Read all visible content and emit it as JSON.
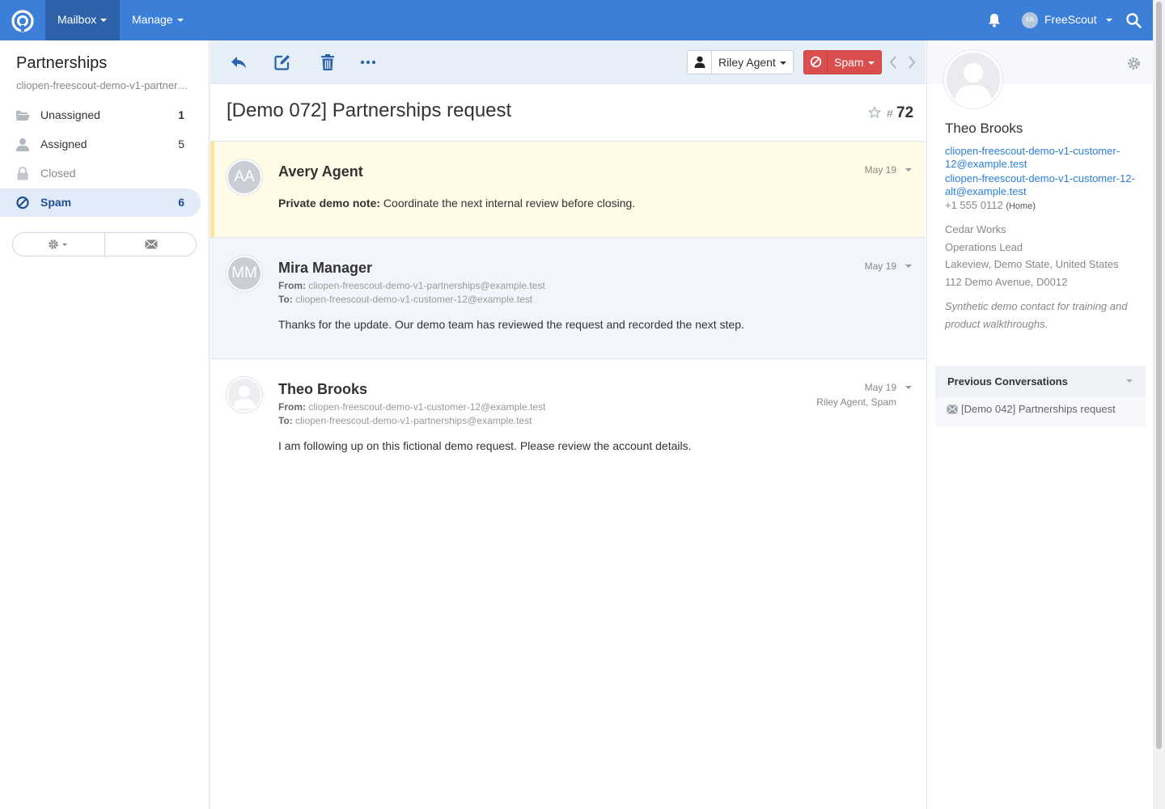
{
  "topnav": {
    "mailbox_label": "Mailbox",
    "manage_label": "Manage",
    "user_initials": "FA",
    "user_name": "FreeScout",
    "accent": "#3c7fd8"
  },
  "sidebar": {
    "mailbox_name": "Partnerships",
    "mailbox_email": "cliopen-freescout-demo-v1-partnerships@example.test",
    "folders": [
      {
        "label": "Unassigned",
        "count": "1"
      },
      {
        "label": "Assigned",
        "count": "5"
      },
      {
        "label": "Closed",
        "count": ""
      },
      {
        "label": "Spam",
        "count": "6"
      }
    ]
  },
  "toolbar": {
    "assignee": "Riley Agent",
    "status": "Spam",
    "status_color": "#dc4e4e"
  },
  "conversation": {
    "title": "[Demo 072] Partnerships request",
    "hash": "#",
    "number": "72"
  },
  "threads": [
    {
      "initials": "AA",
      "name": "Avery Agent",
      "date": "May 19",
      "note_label": "Private demo note:",
      "body": " Coordinate the next internal review before closing."
    },
    {
      "initials": "MM",
      "name": "Mira Manager",
      "date": "May 19",
      "from_label": "From:",
      "from": "cliopen-freescout-demo-v1-partnerships@example.test",
      "to_label": "To:",
      "to": "cliopen-freescout-demo-v1-customer-12@example.test",
      "body": "Thanks for the update. Our demo team has reviewed the request and recorded the next step."
    },
    {
      "name": "Theo Brooks",
      "date": "May 19",
      "extra": "Riley Agent, Spam",
      "from_label": "From:",
      "from": "cliopen-freescout-demo-v1-customer-12@example.test",
      "to_label": "To:",
      "to": "cliopen-freescout-demo-v1-partnerships@example.test",
      "body": "I am following up on this fictional demo request. Please review the account details."
    }
  ],
  "customer": {
    "name": "Theo Brooks",
    "email1": "cliopen-freescout-demo-v1-customer-12@example.test",
    "email2": "cliopen-freescout-demo-v1-customer-12-alt@example.test",
    "phone": "+1 555 0112",
    "phone_type": "(Home)",
    "company": "Cedar Works",
    "job_title": "Operations Lead",
    "location": "Lakeview, Demo State, United States",
    "address": "112 Demo Avenue, D0012",
    "note": "Synthetic demo contact for training and product walkthroughs.",
    "prev_title": "Previous Conversations",
    "prev_items": [
      "[Demo 042] Partnerships request"
    ]
  }
}
